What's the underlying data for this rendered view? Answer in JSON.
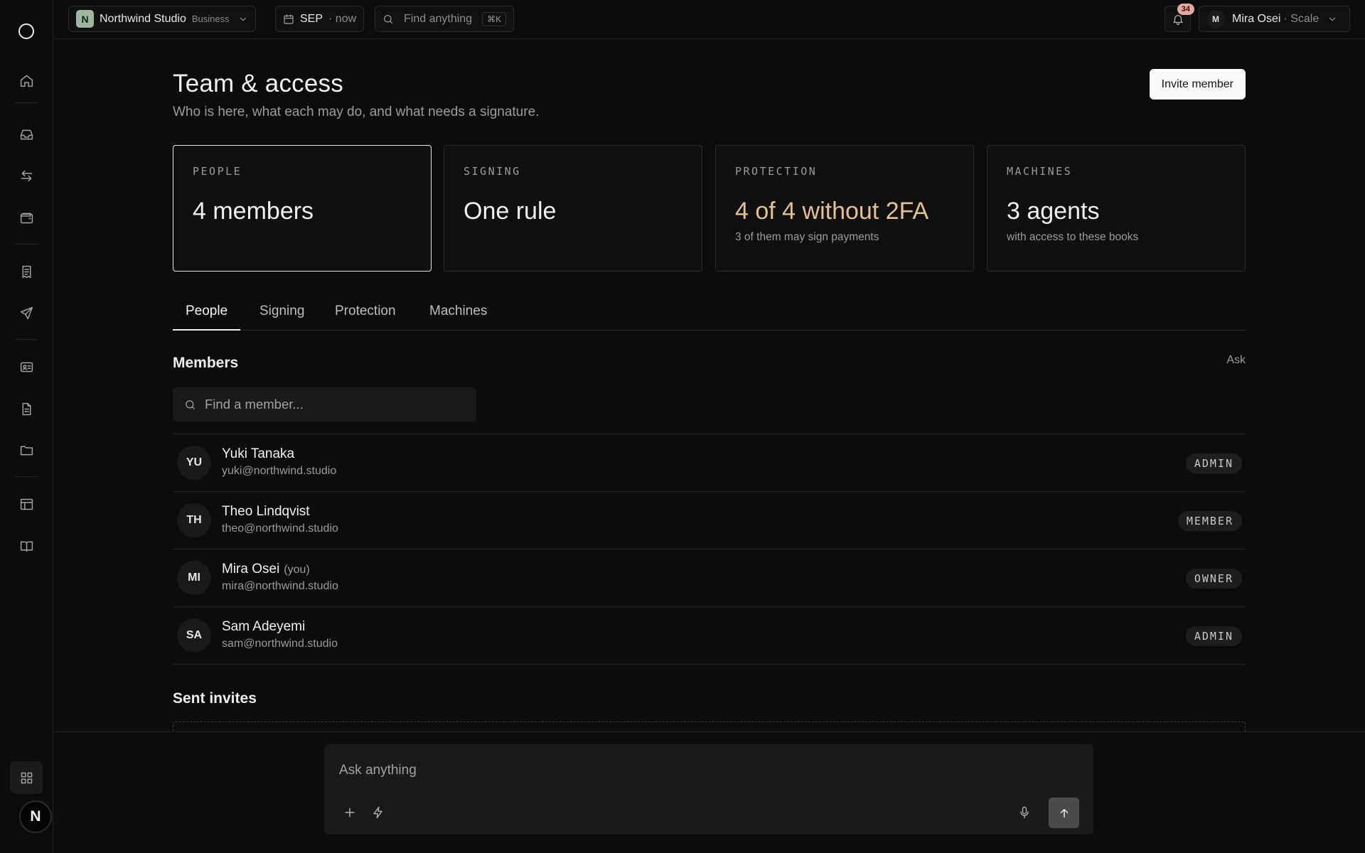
{
  "topbar": {
    "workspace_initial": "N",
    "workspace_name": "Northwind Studio",
    "workspace_plan": "Business",
    "period_label": "SEP",
    "period_suffix": "· now",
    "search_placeholder": "Find anything",
    "search_shortcut": "⌘K",
    "notification_count": "34",
    "user_initial": "M",
    "user_name": "Mira Osei",
    "user_plan": "· Scale"
  },
  "rail": {
    "bottom_badge": "N",
    "icons": [
      "logo-icon",
      "home-icon",
      "inbox-icon",
      "transfer-icon",
      "wallet-icon",
      "receipt-icon",
      "send-icon",
      "contact-card-icon",
      "document-icon",
      "folder-icon",
      "table-icon",
      "book-icon",
      "apps-grid-icon"
    ]
  },
  "page": {
    "title": "Team & access",
    "subtitle": "Who is here, what each may do, and what needs a signature.",
    "invite_button": "Invite member"
  },
  "cards": [
    {
      "key": "PEOPLE",
      "value": "4 members",
      "sub": ""
    },
    {
      "key": "SIGNING",
      "value": "One rule",
      "sub": ""
    },
    {
      "key": "PROTECTION",
      "value": "4 of 4 without 2FA",
      "sub": "3 of them may sign payments"
    },
    {
      "key": "MACHINES",
      "value": "3 agents",
      "sub": "with access to these books"
    }
  ],
  "tabs": [
    "People",
    "Signing",
    "Protection",
    "Machines"
  ],
  "members_section": {
    "title": "Members",
    "ask_link": "Ask",
    "search_placeholder": "Find a member..."
  },
  "members": [
    {
      "initials": "YU",
      "name": "Yuki Tanaka",
      "you": "",
      "email": "yuki@northwind.studio",
      "role": "ADMIN"
    },
    {
      "initials": "TH",
      "name": "Theo Lindqvist",
      "you": "",
      "email": "theo@northwind.studio",
      "role": "MEMBER"
    },
    {
      "initials": "MI",
      "name": "Mira Osei",
      "you": "(you)",
      "email": "mira@northwind.studio",
      "role": "OWNER"
    },
    {
      "initials": "SA",
      "name": "Sam Adeyemi",
      "you": "",
      "email": "sam@northwind.studio",
      "role": "ADMIN"
    }
  ],
  "invites_section": {
    "title": "Sent invites"
  },
  "ask_bar": {
    "placeholder": "Ask anything"
  },
  "colors": {
    "background": "#0c0c0c",
    "warning_accent": "#e3c093",
    "notification_badge": "#e6a9a0",
    "workspace_mark": "#9fb6a3"
  }
}
